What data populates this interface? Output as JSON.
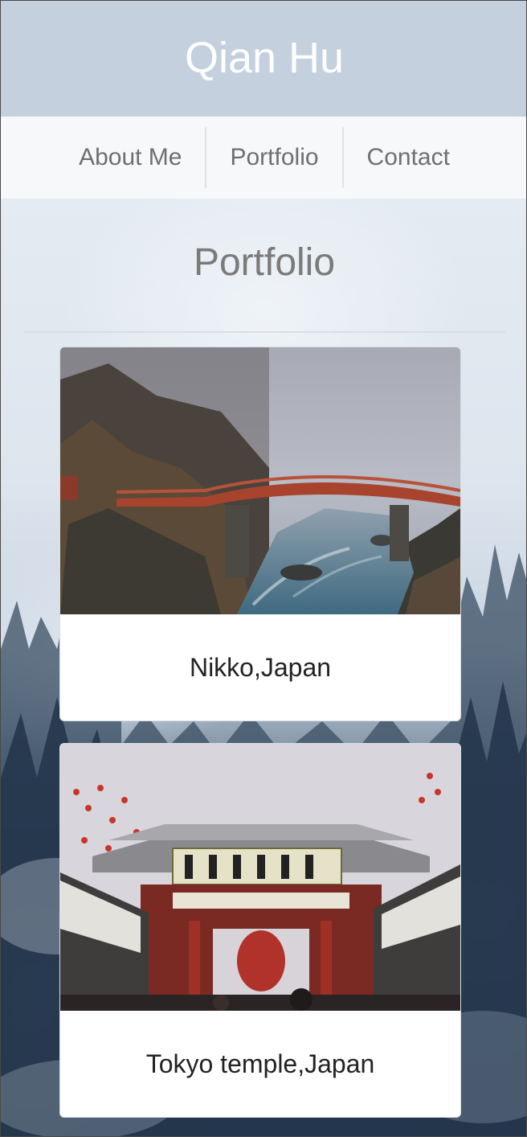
{
  "header": {
    "title": "Qian Hu"
  },
  "nav": {
    "items": [
      {
        "label": "About Me"
      },
      {
        "label": "Portfolio"
      },
      {
        "label": "Contact"
      }
    ]
  },
  "main": {
    "section_title": "Portfolio",
    "cards": [
      {
        "caption": "Nikko,Japan",
        "image": "bridge-over-river-photo"
      },
      {
        "caption": "Tokyo temple,Japan",
        "image": "temple-gate-photo"
      }
    ]
  },
  "colors": {
    "header_bg": "#c4d0de",
    "nav_bg": "#f6f8fa",
    "title_text": "#ffffff",
    "nav_text": "#6f6f6f"
  }
}
